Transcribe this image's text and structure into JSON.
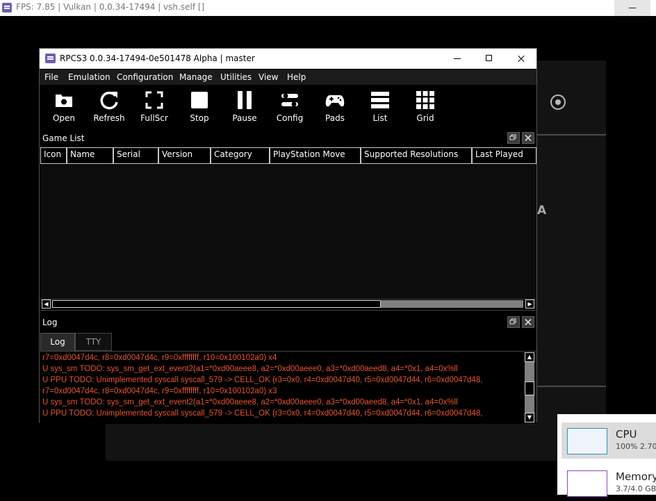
{
  "outer_window": {
    "title": "FPS: 7.85 | Vulkan | 0.0.34-17494 | vsh.self []"
  },
  "background": {
    "partial_letter": "A"
  },
  "task_manager": {
    "cpu": {
      "label": "CPU",
      "value": "100%  2.70"
    },
    "memory": {
      "label": "Memory",
      "value": "3.7/4.0 GB"
    }
  },
  "window": {
    "title": "RPCS3 0.0.34-17494-0e501478 Alpha | master"
  },
  "menu": [
    "File",
    "Emulation",
    "Configuration",
    "Manage",
    "Utilities",
    "View",
    "Help"
  ],
  "toolbar": [
    {
      "label": "Open",
      "icon": "folder-icon"
    },
    {
      "label": "Refresh",
      "icon": "refresh-icon"
    },
    {
      "label": "FullScr",
      "icon": "fullscreen-icon"
    },
    {
      "label": "Stop",
      "icon": "stop-icon"
    },
    {
      "label": "Pause",
      "icon": "pause-icon"
    },
    {
      "label": "Config",
      "icon": "config-icon"
    },
    {
      "label": "Pads",
      "icon": "gamepad-icon"
    },
    {
      "label": "List",
      "icon": "list-icon"
    },
    {
      "label": "Grid",
      "icon": "grid-icon"
    }
  ],
  "game_list": {
    "title": "Game List",
    "columns": [
      "Icon",
      "Name",
      "Serial",
      "Version",
      "Category",
      "PlayStation Move",
      "Supported Resolutions",
      "Last Played"
    ]
  },
  "log_panel": {
    "title": "Log",
    "tabs": [
      "Log",
      "TTY"
    ],
    "active_tab": "Log",
    "lines": [
      "r7=0xd0047d4c, r8=0xd0047d4c, r9=0xffffffff, r10=0x100102a0) x4",
      "U sys_sm TODO: sys_sm_get_ext_event2(a1=*0xd00aeee8, a2=*0xd00aeee0, a3=*0xd00aeed8, a4=*0x1, a4=0x%ll",
      "U PPU TODO: Unimplemented syscall syscall_579 -> CELL_OK (r3=0x0, r4=0xd0047d40, r5=0xd0047d44, r6=0xd0047d48,",
      "r7=0xd0047d4c, r8=0xd0047d4c, r9=0xffffffff, r10=0x100102a0) x3",
      "U sys_sm TODO: sys_sm_get_ext_event2(a1=*0xd00aeee8, a2=*0xd00aeee0, a3=*0xd00aeed8, a4=*0x1, a4=0x%ll",
      "U PPU TODO: Unimplemented syscall syscall_579 -> CELL_OK (r3=0x0, r4=0xd0047d40, r5=0xd0047d44, r6=0xd0047d48,"
    ]
  },
  "colors": {
    "log_text": "#e8542f",
    "app_icon": "#6c5fb5"
  }
}
